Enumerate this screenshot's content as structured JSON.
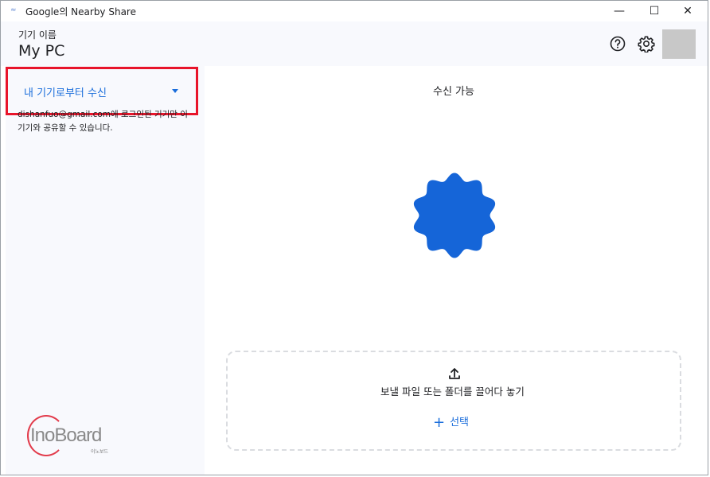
{
  "window": {
    "title": "Google의 Nearby Share",
    "app_icon": "nearby-share-icon",
    "controls": {
      "minimize": "—",
      "maximize": "☐",
      "close": "✕"
    }
  },
  "header": {
    "device_label": "기기 이름",
    "device_name": "My PC",
    "help_icon": "help-circle-icon",
    "settings_icon": "gear-icon"
  },
  "sidebar": {
    "receive_mode": "내 기기로부터 수신",
    "description": "dishanfuo@gmail.com에 로그인된 기기만 이 기기와 공유할 수 있습니다.",
    "logo_text": "InoBoard",
    "logo_sub": "이노보드"
  },
  "main": {
    "status": "수신 가능",
    "dropzone_text": "보낼 파일 또는 폴더를 끌어다 놓기",
    "select_label": "선택",
    "upload_icon": "upload-icon"
  },
  "colors": {
    "accent": "#1a6ddb",
    "blob": "#1565d8",
    "highlight": "#e8142a",
    "panel": "#f8f9fd"
  }
}
